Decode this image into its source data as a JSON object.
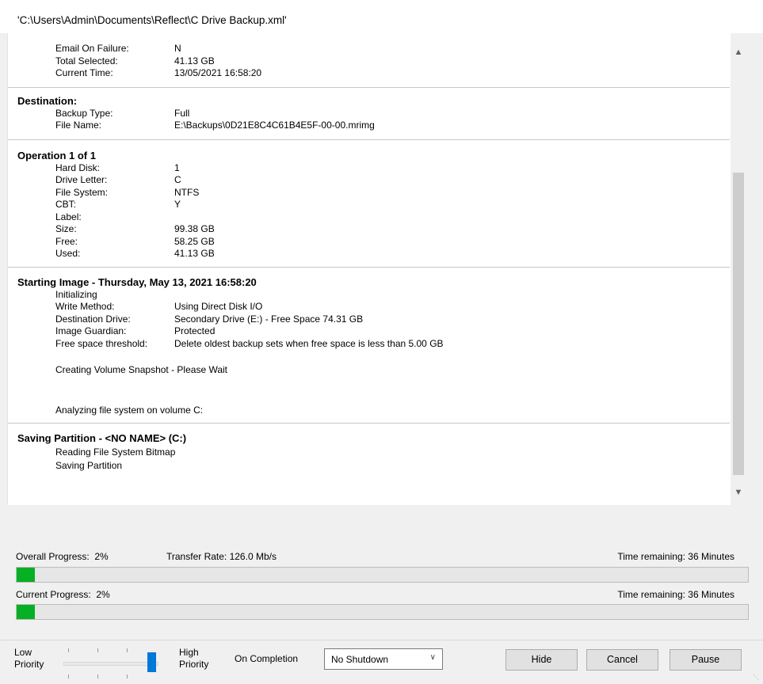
{
  "window": {
    "title": "'C:\\Users\\Admin\\Documents\\Reflect\\C Drive Backup.xml'"
  },
  "log": {
    "top_rows": [
      {
        "label": "Email On Failure:",
        "value": "N"
      },
      {
        "label": "Total Selected:",
        "value": "41.13 GB"
      },
      {
        "label": "Current Time:",
        "value": "13/05/2021 16:58:20"
      }
    ],
    "destination": {
      "heading": "Destination:",
      "rows": [
        {
          "label": "Backup Type:",
          "value": "Full"
        },
        {
          "label": "File Name:",
          "value": "E:\\Backups\\0D21E8C4C61B4E5F-00-00.mrimg"
        }
      ]
    },
    "operation": {
      "heading": "Operation 1 of 1",
      "rows": [
        {
          "label": "Hard Disk:",
          "value": "1"
        },
        {
          "label": "Drive Letter:",
          "value": "C"
        },
        {
          "label": "File System:",
          "value": "NTFS"
        },
        {
          "label": "CBT:",
          "value": "Y"
        },
        {
          "label": "Label:",
          "value": ""
        },
        {
          "label": "Size:",
          "value": "99.38 GB"
        },
        {
          "label": "Free:",
          "value": "58.25 GB"
        },
        {
          "label": "Used:",
          "value": "41.13 GB"
        }
      ]
    },
    "starting_image": {
      "heading": "Starting Image - Thursday, May 13, 2021 16:58:20",
      "initializing": "Initializing",
      "rows": [
        {
          "label": "Write Method:",
          "value": "Using Direct Disk I/O"
        },
        {
          "label": "Destination Drive:",
          "value": "Secondary Drive (E:) - Free Space 74.31 GB"
        },
        {
          "label": "Image Guardian:",
          "value": "Protected"
        },
        {
          "label": "Free space threshold:",
          "value": "Delete oldest backup sets when free space is less than 5.00 GB"
        }
      ],
      "snapshot": "Creating Volume Snapshot - Please Wait",
      "analyzing": "Analyzing file system on volume C:"
    },
    "saving_partition": {
      "heading": "Saving Partition - <NO NAME> (C:)",
      "lines": [
        "Reading File System Bitmap",
        "Saving Partition"
      ]
    }
  },
  "progress": {
    "overall_label": "Overall Progress:",
    "overall_value": "2%",
    "overall_fraction": 0.025,
    "transfer_rate": "Transfer Rate: 126.0 Mb/s",
    "overall_remaining": "Time remaining: 36 Minutes",
    "current_label": "Current Progress:",
    "current_value": "2%",
    "current_fraction": 0.025,
    "current_remaining": "Time remaining: 36 Minutes"
  },
  "bottom": {
    "low_label": "Low Priority",
    "high_label": "High Priority",
    "priority_level": 1.0,
    "on_completion_label": "On Completion",
    "completion_value": "No Shutdown",
    "hide_button": "Hide",
    "cancel_button": "Cancel",
    "pause_button": "Pause"
  },
  "colors": {
    "progress_fill": "#06b025",
    "slider_thumb": "#0078d7"
  }
}
